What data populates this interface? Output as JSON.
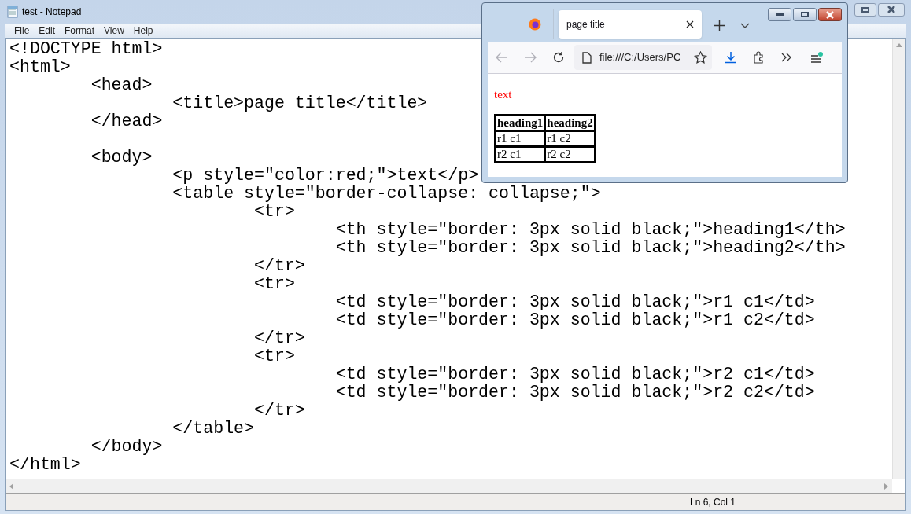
{
  "notepad": {
    "title": "test - Notepad",
    "menu": [
      "File",
      "Edit",
      "Format",
      "View",
      "Help"
    ],
    "line_groups": [
      [
        "<!DOCTYPE html>",
        "<html>",
        "\t<head>",
        "\t\t<title>page title</title>",
        "\t</head>"
      ],
      [
        "\t<body>",
        "\t\t<p style=\"color:red;\">text</p>",
        "\t\t<table style=\"border-collapse: collapse;\">",
        "\t\t\t<tr>",
        "\t\t\t\t<th style=\"border: 3px solid black;\">heading1</th>",
        "\t\t\t\t<th style=\"border: 3px solid black;\">heading2</th>",
        "\t\t\t</tr>",
        "\t\t\t<tr>",
        "\t\t\t\t<td style=\"border: 3px solid black;\">r1 c1</td>",
        "\t\t\t\t<td style=\"border: 3px solid black;\">r1 c2</td>",
        "\t\t\t</tr>",
        "\t\t\t<tr>",
        "\t\t\t\t<td style=\"border: 3px solid black;\">r2 c1</td>",
        "\t\t\t\t<td style=\"border: 3px solid black;\">r2 c2</td>",
        "\t\t\t</tr>",
        "\t\t</table>",
        "\t</body>",
        "</html>"
      ]
    ],
    "status": "Ln 6, Col 1"
  },
  "browser": {
    "tabs": [
      {
        "title": "page title",
        "selected": true
      }
    ],
    "address": "file:///C:/Users/PC",
    "page": {
      "paragraph": "text",
      "table": {
        "columns": [
          "heading1",
          "heading2"
        ],
        "rows": [
          [
            "r1 c1",
            "r1 c2"
          ],
          [
            "r2 c1",
            "r2 c2"
          ]
        ]
      }
    }
  }
}
